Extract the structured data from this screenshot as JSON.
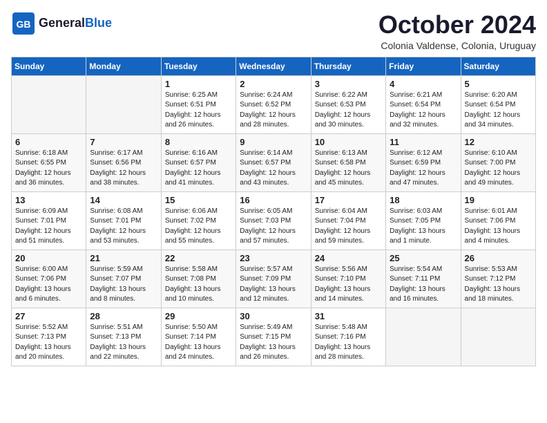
{
  "header": {
    "logo_general": "General",
    "logo_blue": "Blue",
    "month_title": "October 2024",
    "subtitle": "Colonia Valdense, Colonia, Uruguay"
  },
  "days_of_week": [
    "Sunday",
    "Monday",
    "Tuesday",
    "Wednesday",
    "Thursday",
    "Friday",
    "Saturday"
  ],
  "weeks": [
    [
      {
        "day": "",
        "sunrise": "",
        "sunset": "",
        "daylight": ""
      },
      {
        "day": "",
        "sunrise": "",
        "sunset": "",
        "daylight": ""
      },
      {
        "day": "1",
        "sunrise": "Sunrise: 6:25 AM",
        "sunset": "Sunset: 6:51 PM",
        "daylight": "Daylight: 12 hours and 26 minutes."
      },
      {
        "day": "2",
        "sunrise": "Sunrise: 6:24 AM",
        "sunset": "Sunset: 6:52 PM",
        "daylight": "Daylight: 12 hours and 28 minutes."
      },
      {
        "day": "3",
        "sunrise": "Sunrise: 6:22 AM",
        "sunset": "Sunset: 6:53 PM",
        "daylight": "Daylight: 12 hours and 30 minutes."
      },
      {
        "day": "4",
        "sunrise": "Sunrise: 6:21 AM",
        "sunset": "Sunset: 6:54 PM",
        "daylight": "Daylight: 12 hours and 32 minutes."
      },
      {
        "day": "5",
        "sunrise": "Sunrise: 6:20 AM",
        "sunset": "Sunset: 6:54 PM",
        "daylight": "Daylight: 12 hours and 34 minutes."
      }
    ],
    [
      {
        "day": "6",
        "sunrise": "Sunrise: 6:18 AM",
        "sunset": "Sunset: 6:55 PM",
        "daylight": "Daylight: 12 hours and 36 minutes."
      },
      {
        "day": "7",
        "sunrise": "Sunrise: 6:17 AM",
        "sunset": "Sunset: 6:56 PM",
        "daylight": "Daylight: 12 hours and 38 minutes."
      },
      {
        "day": "8",
        "sunrise": "Sunrise: 6:16 AM",
        "sunset": "Sunset: 6:57 PM",
        "daylight": "Daylight: 12 hours and 41 minutes."
      },
      {
        "day": "9",
        "sunrise": "Sunrise: 6:14 AM",
        "sunset": "Sunset: 6:57 PM",
        "daylight": "Daylight: 12 hours and 43 minutes."
      },
      {
        "day": "10",
        "sunrise": "Sunrise: 6:13 AM",
        "sunset": "Sunset: 6:58 PM",
        "daylight": "Daylight: 12 hours and 45 minutes."
      },
      {
        "day": "11",
        "sunrise": "Sunrise: 6:12 AM",
        "sunset": "Sunset: 6:59 PM",
        "daylight": "Daylight: 12 hours and 47 minutes."
      },
      {
        "day": "12",
        "sunrise": "Sunrise: 6:10 AM",
        "sunset": "Sunset: 7:00 PM",
        "daylight": "Daylight: 12 hours and 49 minutes."
      }
    ],
    [
      {
        "day": "13",
        "sunrise": "Sunrise: 6:09 AM",
        "sunset": "Sunset: 7:01 PM",
        "daylight": "Daylight: 12 hours and 51 minutes."
      },
      {
        "day": "14",
        "sunrise": "Sunrise: 6:08 AM",
        "sunset": "Sunset: 7:01 PM",
        "daylight": "Daylight: 12 hours and 53 minutes."
      },
      {
        "day": "15",
        "sunrise": "Sunrise: 6:06 AM",
        "sunset": "Sunset: 7:02 PM",
        "daylight": "Daylight: 12 hours and 55 minutes."
      },
      {
        "day": "16",
        "sunrise": "Sunrise: 6:05 AM",
        "sunset": "Sunset: 7:03 PM",
        "daylight": "Daylight: 12 hours and 57 minutes."
      },
      {
        "day": "17",
        "sunrise": "Sunrise: 6:04 AM",
        "sunset": "Sunset: 7:04 PM",
        "daylight": "Daylight: 12 hours and 59 minutes."
      },
      {
        "day": "18",
        "sunrise": "Sunrise: 6:03 AM",
        "sunset": "Sunset: 7:05 PM",
        "daylight": "Daylight: 13 hours and 1 minute."
      },
      {
        "day": "19",
        "sunrise": "Sunrise: 6:01 AM",
        "sunset": "Sunset: 7:06 PM",
        "daylight": "Daylight: 13 hours and 4 minutes."
      }
    ],
    [
      {
        "day": "20",
        "sunrise": "Sunrise: 6:00 AM",
        "sunset": "Sunset: 7:06 PM",
        "daylight": "Daylight: 13 hours and 6 minutes."
      },
      {
        "day": "21",
        "sunrise": "Sunrise: 5:59 AM",
        "sunset": "Sunset: 7:07 PM",
        "daylight": "Daylight: 13 hours and 8 minutes."
      },
      {
        "day": "22",
        "sunrise": "Sunrise: 5:58 AM",
        "sunset": "Sunset: 7:08 PM",
        "daylight": "Daylight: 13 hours and 10 minutes."
      },
      {
        "day": "23",
        "sunrise": "Sunrise: 5:57 AM",
        "sunset": "Sunset: 7:09 PM",
        "daylight": "Daylight: 13 hours and 12 minutes."
      },
      {
        "day": "24",
        "sunrise": "Sunrise: 5:56 AM",
        "sunset": "Sunset: 7:10 PM",
        "daylight": "Daylight: 13 hours and 14 minutes."
      },
      {
        "day": "25",
        "sunrise": "Sunrise: 5:54 AM",
        "sunset": "Sunset: 7:11 PM",
        "daylight": "Daylight: 13 hours and 16 minutes."
      },
      {
        "day": "26",
        "sunrise": "Sunrise: 5:53 AM",
        "sunset": "Sunset: 7:12 PM",
        "daylight": "Daylight: 13 hours and 18 minutes."
      }
    ],
    [
      {
        "day": "27",
        "sunrise": "Sunrise: 5:52 AM",
        "sunset": "Sunset: 7:13 PM",
        "daylight": "Daylight: 13 hours and 20 minutes."
      },
      {
        "day": "28",
        "sunrise": "Sunrise: 5:51 AM",
        "sunset": "Sunset: 7:13 PM",
        "daylight": "Daylight: 13 hours and 22 minutes."
      },
      {
        "day": "29",
        "sunrise": "Sunrise: 5:50 AM",
        "sunset": "Sunset: 7:14 PM",
        "daylight": "Daylight: 13 hours and 24 minutes."
      },
      {
        "day": "30",
        "sunrise": "Sunrise: 5:49 AM",
        "sunset": "Sunset: 7:15 PM",
        "daylight": "Daylight: 13 hours and 26 minutes."
      },
      {
        "day": "31",
        "sunrise": "Sunrise: 5:48 AM",
        "sunset": "Sunset: 7:16 PM",
        "daylight": "Daylight: 13 hours and 28 minutes."
      },
      {
        "day": "",
        "sunrise": "",
        "sunset": "",
        "daylight": ""
      },
      {
        "day": "",
        "sunrise": "",
        "sunset": "",
        "daylight": ""
      }
    ]
  ]
}
